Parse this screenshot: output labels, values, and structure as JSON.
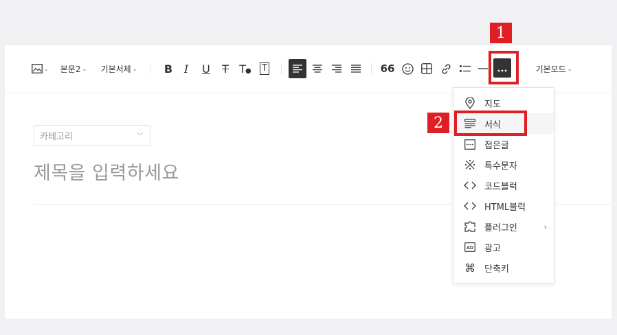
{
  "toolbar": {
    "image_icon": "image-icon",
    "paragraph_style": "본문2",
    "font_family": "기본서체",
    "bold": "B",
    "italic": "I",
    "underline": "U",
    "strikethrough": "T",
    "text_color": "T",
    "text_bg": "T",
    "mode": "기본모드"
  },
  "editor": {
    "category_placeholder": "카테고리",
    "title_placeholder": "제목을 입력하세요"
  },
  "more_menu": {
    "items": [
      {
        "label": "지도",
        "icon": "map-pin-icon"
      },
      {
        "label": "서식",
        "icon": "template-icon"
      },
      {
        "label": "접은글",
        "icon": "fold-icon"
      },
      {
        "label": "특수문자",
        "icon": "special-char-icon"
      },
      {
        "label": "코드블럭",
        "icon": "code-icon"
      },
      {
        "label": "HTML블럭",
        "icon": "html-code-icon"
      },
      {
        "label": "플러그인",
        "icon": "plugin-icon"
      },
      {
        "label": "광고",
        "icon": "ad-icon"
      },
      {
        "label": "단축키",
        "icon": "command-icon"
      }
    ]
  },
  "annotations": {
    "badge1": "1",
    "badge2": "2",
    "color": "#e01e25"
  },
  "colors": {
    "dark_button": "#333333",
    "background": "#f1f1f3"
  }
}
